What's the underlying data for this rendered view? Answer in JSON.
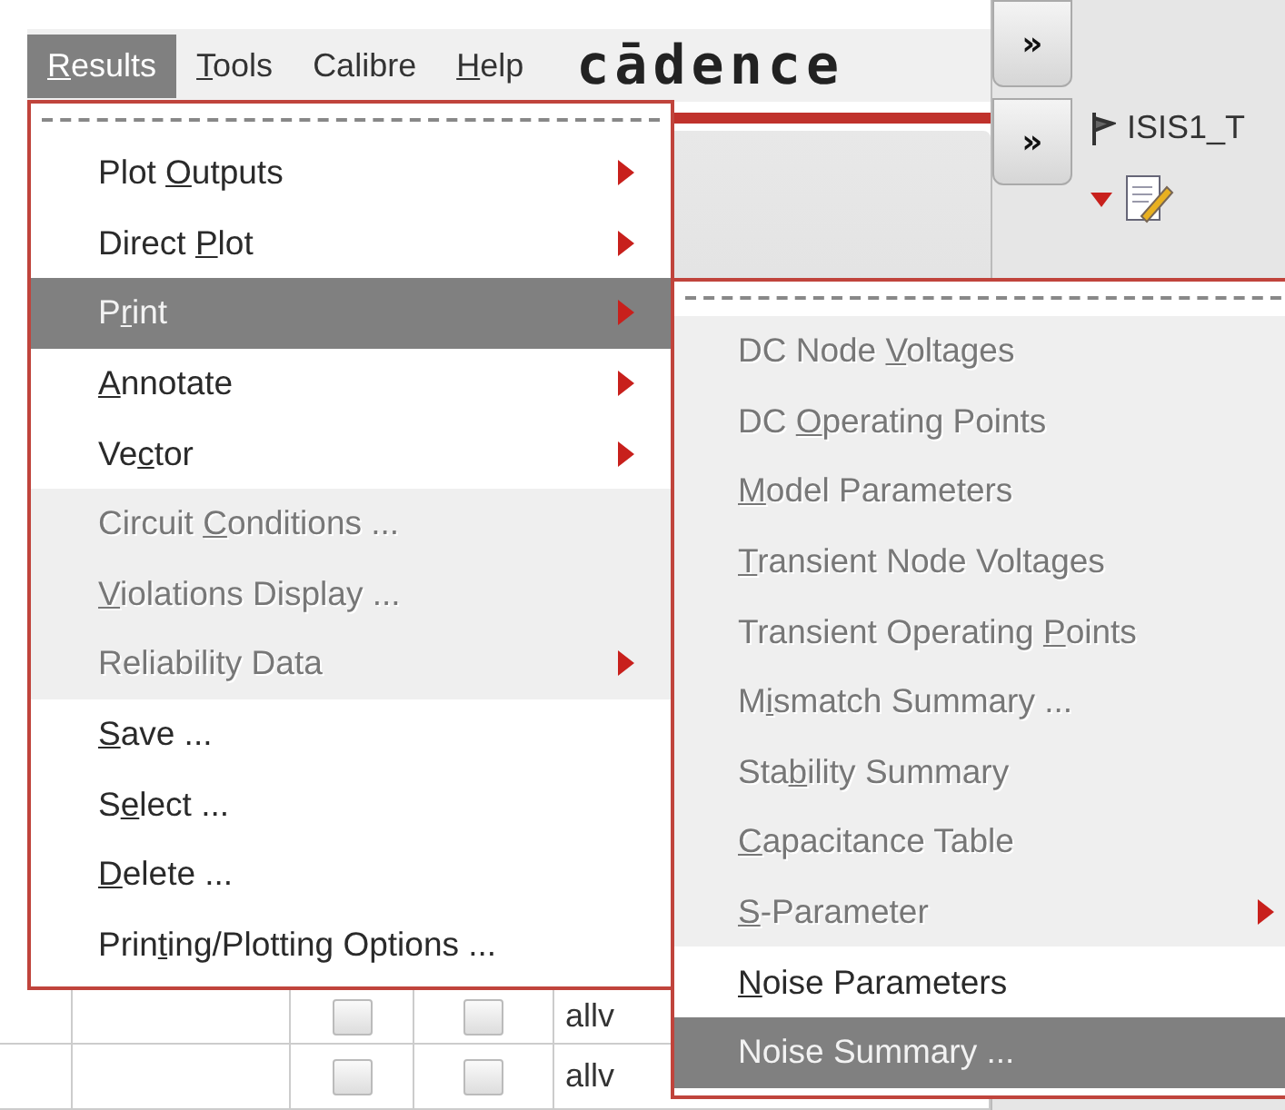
{
  "menubar": {
    "items": [
      {
        "key": "R",
        "post": "esults",
        "selected": true
      },
      {
        "key": "T",
        "post": "ools",
        "selected": false
      },
      {
        "pre": "Calibre",
        "selected": false
      },
      {
        "key": "H",
        "post": "elp",
        "selected": false
      }
    ],
    "logo": "cādence"
  },
  "toolbar": {
    "expand_buttons": [
      "»",
      "»"
    ],
    "cell_name": "ISIS1_T"
  },
  "results_menu": {
    "items": [
      {
        "pre": "Plot ",
        "key": "O",
        "post": "utputs",
        "submenu": true,
        "disabled": false,
        "selected": false
      },
      {
        "pre": "Direct ",
        "key": "P",
        "post": "lot",
        "submenu": true,
        "disabled": false,
        "selected": false
      },
      {
        "pre": "P",
        "key": "r",
        "post": "int",
        "submenu": true,
        "disabled": false,
        "selected": true
      },
      {
        "key": "A",
        "post": "nnotate",
        "submenu": true,
        "disabled": false,
        "selected": false
      },
      {
        "pre": "Ve",
        "key": "c",
        "post": "tor",
        "submenu": true,
        "disabled": false,
        "selected": false
      },
      {
        "pre": "Circuit ",
        "key": "C",
        "post": "onditions ...",
        "submenu": false,
        "disabled": true,
        "selected": false
      },
      {
        "key": "V",
        "post": "iolations Display ...",
        "submenu": false,
        "disabled": true,
        "selected": false
      },
      {
        "pre": "Reliability Data",
        "submenu": true,
        "disabled": true,
        "selected": false
      },
      {
        "key": "S",
        "post": "ave ...",
        "submenu": false,
        "disabled": false,
        "selected": false
      },
      {
        "pre": "S",
        "key": "e",
        "post": "lect ...",
        "submenu": false,
        "disabled": false,
        "selected": false
      },
      {
        "key": "D",
        "post": "elete ...",
        "submenu": false,
        "disabled": false,
        "selected": false
      },
      {
        "pre": "Prin",
        "key": "t",
        "post": "ing/Plotting Options ...",
        "submenu": false,
        "disabled": false,
        "selected": false
      }
    ]
  },
  "print_submenu": {
    "items": [
      {
        "pre": "DC Node ",
        "key": "V",
        "post": "oltages",
        "submenu": false,
        "disabled": true,
        "selected": false
      },
      {
        "pre": "DC ",
        "key": "O",
        "post": "perating Points",
        "submenu": false,
        "disabled": true,
        "selected": false
      },
      {
        "key": "M",
        "post": "odel Parameters",
        "submenu": false,
        "disabled": true,
        "selected": false
      },
      {
        "key": "T",
        "post": "ransient Node Voltages",
        "submenu": false,
        "disabled": true,
        "selected": false
      },
      {
        "pre": "Transient Operating ",
        "key": "P",
        "post": "oints",
        "submenu": false,
        "disabled": true,
        "selected": false
      },
      {
        "pre": "M",
        "key": "i",
        "post": "smatch Summary ...",
        "submenu": false,
        "disabled": true,
        "selected": false
      },
      {
        "pre": "Sta",
        "key": "b",
        "post": "ility Summary",
        "submenu": false,
        "disabled": true,
        "selected": false
      },
      {
        "key": "C",
        "post": "apacitance Table",
        "submenu": false,
        "disabled": true,
        "selected": false
      },
      {
        "key": "S",
        "post": "-Parameter",
        "submenu": true,
        "disabled": true,
        "selected": false
      },
      {
        "key": "N",
        "post": "oise Parameters",
        "submenu": false,
        "disabled": false,
        "selected": false
      },
      {
        "pre": "Noise Summary ...",
        "submenu": false,
        "disabled": false,
        "selected": true
      }
    ]
  },
  "table": {
    "rows": [
      {
        "checked_1": false,
        "checked_2": false,
        "column_3": "allv"
      },
      {
        "checked_1": false,
        "checked_2": false,
        "column_3": "allv"
      }
    ]
  }
}
